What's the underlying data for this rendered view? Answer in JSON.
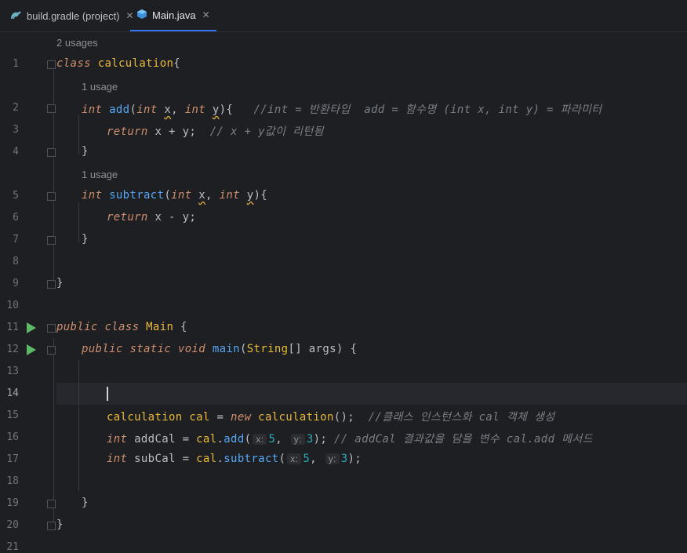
{
  "tabs": [
    {
      "label": "build.gradle (project)",
      "icon": "gradle-icon",
      "active": false
    },
    {
      "label": "Main.java",
      "icon": "java-class-icon",
      "active": true
    }
  ],
  "hints": {
    "h1": "2 usages",
    "h2": "1 usage",
    "h3": "1 usage"
  },
  "line_numbers": [
    "1",
    "2",
    "3",
    "4",
    "5",
    "6",
    "7",
    "8",
    "9",
    "10",
    "11",
    "12",
    "13",
    "14",
    "15",
    "16",
    "17",
    "18",
    "19",
    "20",
    "21"
  ],
  "code": {
    "l1": {
      "kw": "class",
      "name": "calculation",
      "rest": "{"
    },
    "l2": {
      "t1": "int",
      "fn": "add",
      "p1": "(",
      "t2": "int",
      "x": "x",
      "c": ", ",
      "t3": "int",
      "y": "y",
      "end": "){",
      "cmt": "//int = 반환타입  add = 함수명 (int x, int y) = 파라미터"
    },
    "l3": {
      "kw": "return",
      "expr": " x + y;",
      "cmt": "// x + y값이 리턴됨"
    },
    "l4": "}",
    "l5": {
      "t1": "int",
      "fn": "subtract",
      "p1": "(",
      "t2": "int",
      "x": "x",
      "c": ", ",
      "t3": "int",
      "y": "y",
      "end": "){"
    },
    "l6": {
      "kw": "return",
      "expr": " x - y;"
    },
    "l7": "}",
    "l9": "}",
    "l11": {
      "kw1": "public",
      "kw2": "class",
      "name": "Main",
      "rest": " {"
    },
    "l12": {
      "kw1": "public",
      "kw2": "static",
      "kw3": "void",
      "fn": "main",
      "p1": "(",
      "cls": "String",
      "rest": "[] args) {"
    },
    "l15": {
      "cls": "calculation",
      "var": " cal",
      "eq": " = ",
      "kw": "new",
      "cls2": " calculation",
      "rest": "();",
      "cmt": "//클래스 인스턴스화 cal 객체 생성"
    },
    "l16": {
      "t": "int",
      "var": " addCal",
      "eq": " = ",
      "obj": "cal",
      "dot": ".",
      "fn": "add",
      "p1": "(",
      "hx": "x:",
      "v1": "5",
      "c": ", ",
      "hy": "y:",
      "v2": "3",
      "end": ");",
      "cmt": "// addCal 결과값을 담을 변수 cal.add 메서드"
    },
    "l17": {
      "t": "int",
      "var": " subCal",
      "eq": " = ",
      "obj": "cal",
      "dot": ".",
      "fn": "subtract",
      "p1": "(",
      "hx": "x:",
      "v1": "5",
      "c": ", ",
      "hy": "y:",
      "v2": "3",
      "end": ");"
    },
    "l19": "}",
    "l20": "}"
  },
  "colors": {
    "keyword": "#cf8e6d",
    "function": "#56a8f5",
    "class": "#e8ba36",
    "number": "#2aacb8",
    "comment": "#7a7e85"
  }
}
